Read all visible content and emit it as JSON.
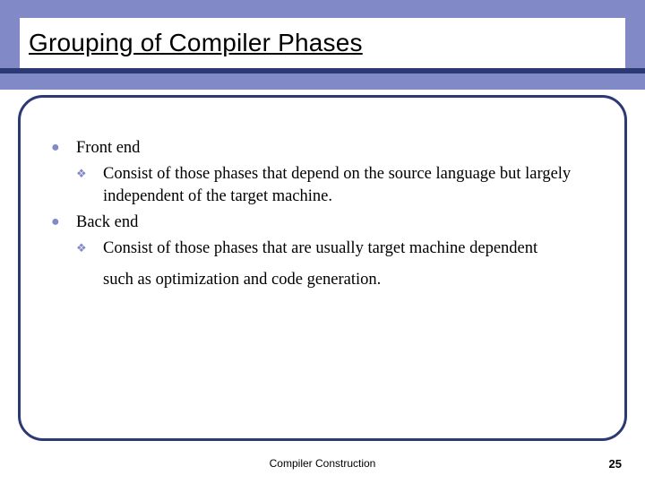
{
  "slide": {
    "title": "Grouping of Compiler Phases",
    "items": [
      {
        "label": "Front end",
        "sub": [
          "Consist of those phases that depend on the source language but largely independent of the target machine."
        ]
      },
      {
        "label": "Back end",
        "sub": [
          "Consist of those phases that are usually target machine dependent"
        ]
      }
    ],
    "trailing_line": "such as optimization and code generation."
  },
  "footer": {
    "center": "Compiler Construction",
    "page": "25"
  }
}
